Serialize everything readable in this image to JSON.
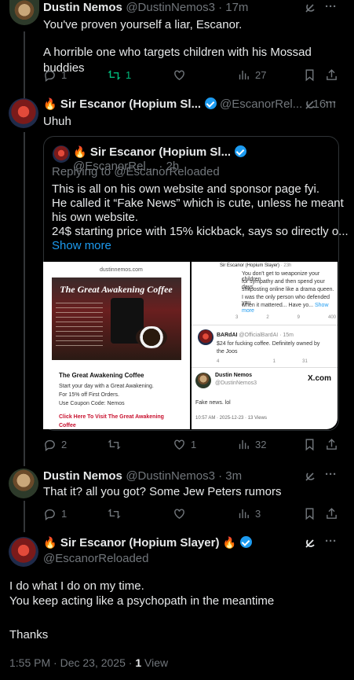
{
  "post1": {
    "name": "Dustin Nemos",
    "handle_time": "@DustinNemos3 · 17m",
    "line1": "You've proven yourself a liar, Escanor.",
    "line2": "A horrible one who targets children with his Mossad buddies",
    "replies": "1",
    "reposts": "1",
    "views": "27"
  },
  "post2": {
    "name": "Sir Escanor (Hopium Sl...",
    "handle_time": "@EscanorRel... · 16m",
    "text": "Uhuh",
    "replies": "2",
    "likes": "1",
    "views": "32",
    "quote": {
      "name": "Sir Escanor (Hopium Sl...",
      "handle_time": "@EscanorRel... · 2h",
      "replying": "Replying to @EscanorReloaded",
      "lines": [
        "This is all on his own website and sponsor page fyi.",
        "He called it “Fake News” which is cute, unless he meant",
        "his own website.",
        "24$ starting price with 15% kickback, says so directly o..."
      ],
      "show_more": "Show more",
      "img1": {
        "site": "dustinnemos.com",
        "banner": "The Great Awakening Coffee",
        "title": "The Great Awakening Coffee",
        "l1": "Start your day with a Great Awakening.",
        "l2": "For 15% off First Orders.",
        "l3": "Use Coupon Code: Nemos",
        "cta": "Click Here To Visit The Great Awakening Coffee"
      },
      "img2": {
        "name": "Sir Escanor (Hopium Slayer)",
        "time": "· 23h",
        "t1": "You don't get to weaponize your children",
        "t2": "for sympathy and then spend your days",
        "t3": "shitposting online like a drama queen.",
        "t4": "I was the only person who defended you",
        "t5": "when it mattered... Have yo...",
        "t5b": "Show more",
        "m1": "3",
        "m2": "2",
        "m3": "9",
        "m4": "400",
        "bard_name": "BARdAI",
        "bard_handle": "@OfficialBardAI · 15m",
        "bard_t1": "$24 for fucking coffee. Definitely owned by",
        "bard_t2": "the Joos",
        "b1": "4",
        "b3": "1",
        "b4": "31",
        "dn_name": "Dustin Nemos",
        "dn_handle": "@DustinNemos3",
        "xcom": "X.com",
        "fake": "Fake news. lol",
        "stamp": "10:57 AM · 2025-12-23 · 13 Views"
      }
    }
  },
  "post3": {
    "name": "Dustin Nemos",
    "handle_time": "@DustinNemos3 · 3m",
    "text": "That it? all you got? Some Jew Peters rumors",
    "replies": "1",
    "views": "3"
  },
  "post4": {
    "name": "Sir Escanor (Hopium Slayer)",
    "handle": "@EscanorReloaded",
    "l1": "I do what I do on my time.",
    "l2": "You keep acting like a psychopath in the meantime",
    "l3": "Thanks",
    "stamp": "1:55 PM · Dec 23, 2025 · ",
    "views": "1",
    "views_label": "View"
  }
}
